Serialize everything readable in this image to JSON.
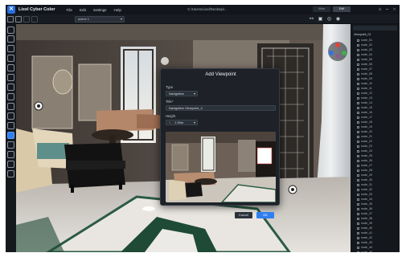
{
  "app": {
    "name": "Lixel Cyber Color",
    "menus": [
      "File",
      "Edit",
      "Settings",
      "Help"
    ],
    "file_path": "C:/Users/Lixel/Desktop/...",
    "view_modes": [
      "View",
      "Edit"
    ]
  },
  "toolbar": {
    "scene_select": "scene 1"
  },
  "dialog": {
    "title": "Add Viewpoint",
    "type_label": "Type",
    "type_value": "Navigation",
    "title_label": "Title*",
    "title_value": "Navigation Viewpoint_4",
    "height_label": "Height",
    "height_value": "1.59m",
    "height_prefix": "↑",
    "cancel_label": "Cancel",
    "ok_label": "OK"
  },
  "right_panel": {
    "root_label": "Viewpoint_01",
    "items": [
      "node_01",
      "node_02",
      "node_03",
      "node_04",
      "node_05",
      "node_06",
      "node_07",
      "node_08",
      "node_09",
      "node_10",
      "node_11",
      "node_12",
      "node_13",
      "node_14",
      "node_15",
      "node_16",
      "node_17",
      "node_18",
      "node_19",
      "node_20",
      "node_21",
      "node_22",
      "node_23",
      "node_24",
      "node_25",
      "node_26",
      "node_27",
      "node_28",
      "node_29",
      "node_30",
      "node_31",
      "node_32",
      "node_33",
      "node_34",
      "node_35",
      "node_36",
      "node_37",
      "node_38",
      "node_39",
      "node_40",
      "node_41",
      "node_42",
      "node_43",
      "node_44",
      "node_45"
    ]
  },
  "colors": {
    "accent": "#2f7ff0",
    "titlebar": "#12161c",
    "panel": "#14181d",
    "dialog": "#1e2228"
  },
  "icons": {
    "left_tools": [
      "cursor-icon",
      "pencil-icon",
      "node-icon",
      "polygon-icon",
      "hexagon-icon",
      "sun-icon",
      "hand-icon",
      "camera-icon",
      "video-icon",
      "box-icon",
      "layers-icon",
      "viewpoint-icon",
      "floorplan-icon",
      "document-icon",
      "page-icon",
      "trash-icon"
    ]
  }
}
